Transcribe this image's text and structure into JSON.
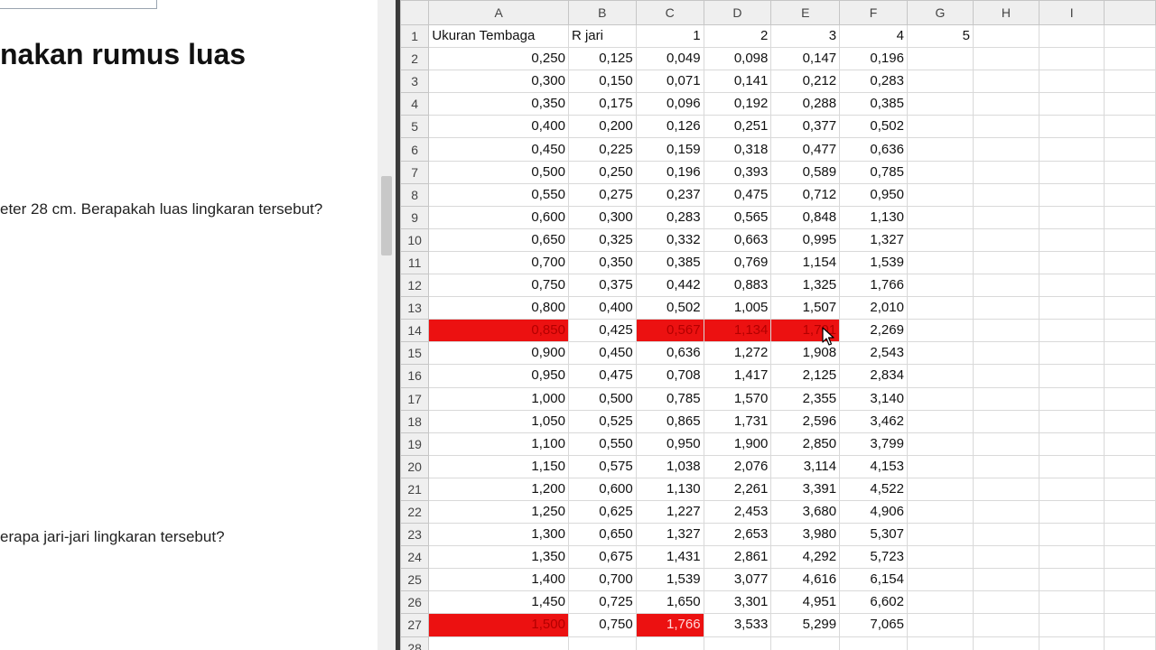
{
  "document": {
    "heading": "nakan rumus luas",
    "question_1": "eter 28 cm. Berapakah luas lingkaran tersebut?",
    "question_2": "erapa jari-jari lingkaran tersebut?"
  },
  "spreadsheet": {
    "columns": [
      "A",
      "B",
      "C",
      "D",
      "E",
      "F",
      "G",
      "H",
      "I"
    ],
    "header_row": {
      "row": "1",
      "cells": [
        "Ukuran Tembaga",
        "R jari",
        "1",
        "2",
        "3",
        "4",
        "5",
        "",
        ""
      ]
    },
    "rows": [
      [
        "2",
        "0,250",
        "0,125",
        "0,049",
        "0,098",
        "0,147",
        "0,196"
      ],
      [
        "3",
        "0,300",
        "0,150",
        "0,071",
        "0,141",
        "0,212",
        "0,283"
      ],
      [
        "4",
        "0,350",
        "0,175",
        "0,096",
        "0,192",
        "0,288",
        "0,385"
      ],
      [
        "5",
        "0,400",
        "0,200",
        "0,126",
        "0,251",
        "0,377",
        "0,502"
      ],
      [
        "6",
        "0,450",
        "0,225",
        "0,159",
        "0,318",
        "0,477",
        "0,636"
      ],
      [
        "7",
        "0,500",
        "0,250",
        "0,196",
        "0,393",
        "0,589",
        "0,785"
      ],
      [
        "8",
        "0,550",
        "0,275",
        "0,237",
        "0,475",
        "0,712",
        "0,950"
      ],
      [
        "9",
        "0,600",
        "0,300",
        "0,283",
        "0,565",
        "0,848",
        "1,130"
      ],
      [
        "10",
        "0,650",
        "0,325",
        "0,332",
        "0,663",
        "0,995",
        "1,327"
      ],
      [
        "11",
        "0,700",
        "0,350",
        "0,385",
        "0,769",
        "1,154",
        "1,539"
      ],
      [
        "12",
        "0,750",
        "0,375",
        "0,442",
        "0,883",
        "1,325",
        "1,766"
      ],
      [
        "13",
        "0,800",
        "0,400",
        "0,502",
        "1,005",
        "1,507",
        "2,010"
      ],
      [
        "14",
        "0,850",
        "0,425",
        "0,567",
        "1,134",
        "1,701",
        "2,269"
      ],
      [
        "15",
        "0,900",
        "0,450",
        "0,636",
        "1,272",
        "1,908",
        "2,543"
      ],
      [
        "16",
        "0,950",
        "0,475",
        "0,708",
        "1,417",
        "2,125",
        "2,834"
      ],
      [
        "17",
        "1,000",
        "0,500",
        "0,785",
        "1,570",
        "2,355",
        "3,140"
      ],
      [
        "18",
        "1,050",
        "0,525",
        "0,865",
        "1,731",
        "2,596",
        "3,462"
      ],
      [
        "19",
        "1,100",
        "0,550",
        "0,950",
        "1,900",
        "2,850",
        "3,799"
      ],
      [
        "20",
        "1,150",
        "0,575",
        "1,038",
        "2,076",
        "3,114",
        "4,153"
      ],
      [
        "21",
        "1,200",
        "0,600",
        "1,130",
        "2,261",
        "3,391",
        "4,522"
      ],
      [
        "22",
        "1,250",
        "0,625",
        "1,227",
        "2,453",
        "3,680",
        "4,906"
      ],
      [
        "23",
        "1,300",
        "0,650",
        "1,327",
        "2,653",
        "3,980",
        "5,307"
      ],
      [
        "24",
        "1,350",
        "0,675",
        "1,431",
        "2,861",
        "4,292",
        "5,723"
      ],
      [
        "25",
        "1,400",
        "0,700",
        "1,539",
        "3,077",
        "4,616",
        "6,154"
      ],
      [
        "26",
        "1,450",
        "0,725",
        "1,650",
        "3,301",
        "4,951",
        "6,602"
      ],
      [
        "27",
        "1,500",
        "0,750",
        "1,766",
        "3,533",
        "5,299",
        "7,065"
      ],
      [
        "28",
        "",
        "",
        "",
        "",
        "",
        ""
      ]
    ],
    "highlights": [
      {
        "row": "14",
        "col": "A",
        "style": "red"
      },
      {
        "row": "14",
        "col": "C",
        "style": "red"
      },
      {
        "row": "14",
        "col": "D",
        "style": "red"
      },
      {
        "row": "14",
        "col": "E",
        "style": "red"
      },
      {
        "row": "27",
        "col": "A",
        "style": "red"
      },
      {
        "row": "27",
        "col": "C",
        "style": "redw"
      }
    ],
    "highlight_color": "#ec1111"
  },
  "cursor": {
    "icon": "mouse-pointer-icon"
  }
}
